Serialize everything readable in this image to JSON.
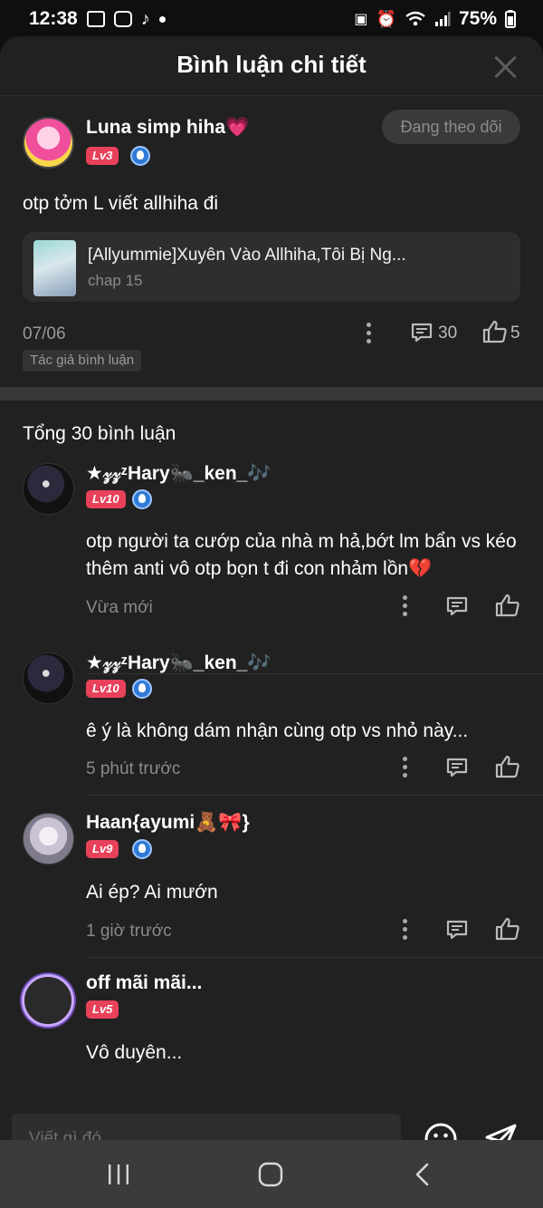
{
  "status_bar": {
    "time": "12:38",
    "battery": "75%"
  },
  "header": {
    "title": "Bình luận chi tiết"
  },
  "post": {
    "username": "Luna simp hiha💗",
    "level": "Lv3",
    "follow_label": "Đang theo dõi",
    "text": "otp tởm L viết allhiha đi",
    "story_title": "[Allyummie]Xuyên Vào Allhiha,Tôi Bị Ng...",
    "story_chapter": "chap 15",
    "date": "07/06",
    "comment_count": "30",
    "like_count": "5",
    "author_tag": "Tác giả bình luận"
  },
  "total_label": "Tổng 30 bình luận",
  "comments": [
    {
      "username": "★𝓏𝓏ᶻHary🐜_ken_🎶",
      "level": "Lv10",
      "text": "otp người ta cướp của nhà m hả,bớt lm bẩn vs kéo thêm anti vô otp bọn t đi con nhảm lồn💔",
      "time": "Vừa mới"
    },
    {
      "username": "★𝓏𝓏ᶻHary🐜_ken_🎶",
      "level": "Lv10",
      "text": "ê ý là không dám nhận cùng otp vs nhỏ này...",
      "time": "5 phút trước"
    },
    {
      "username": "Haan{ayumi🧸🎀}",
      "level": "Lv9",
      "text": "Ai ép? Ai mướn",
      "time": "1 giờ trước"
    },
    {
      "username": "off mãi mãi...",
      "level": "Lv5",
      "text": "Vô duyên..."
    }
  ],
  "input": {
    "placeholder": "Viết gì đó"
  },
  "colors": {
    "sheet_bg": "#212121",
    "level_badge": "#e8415a",
    "verified_badge": "#2f7ad6"
  }
}
